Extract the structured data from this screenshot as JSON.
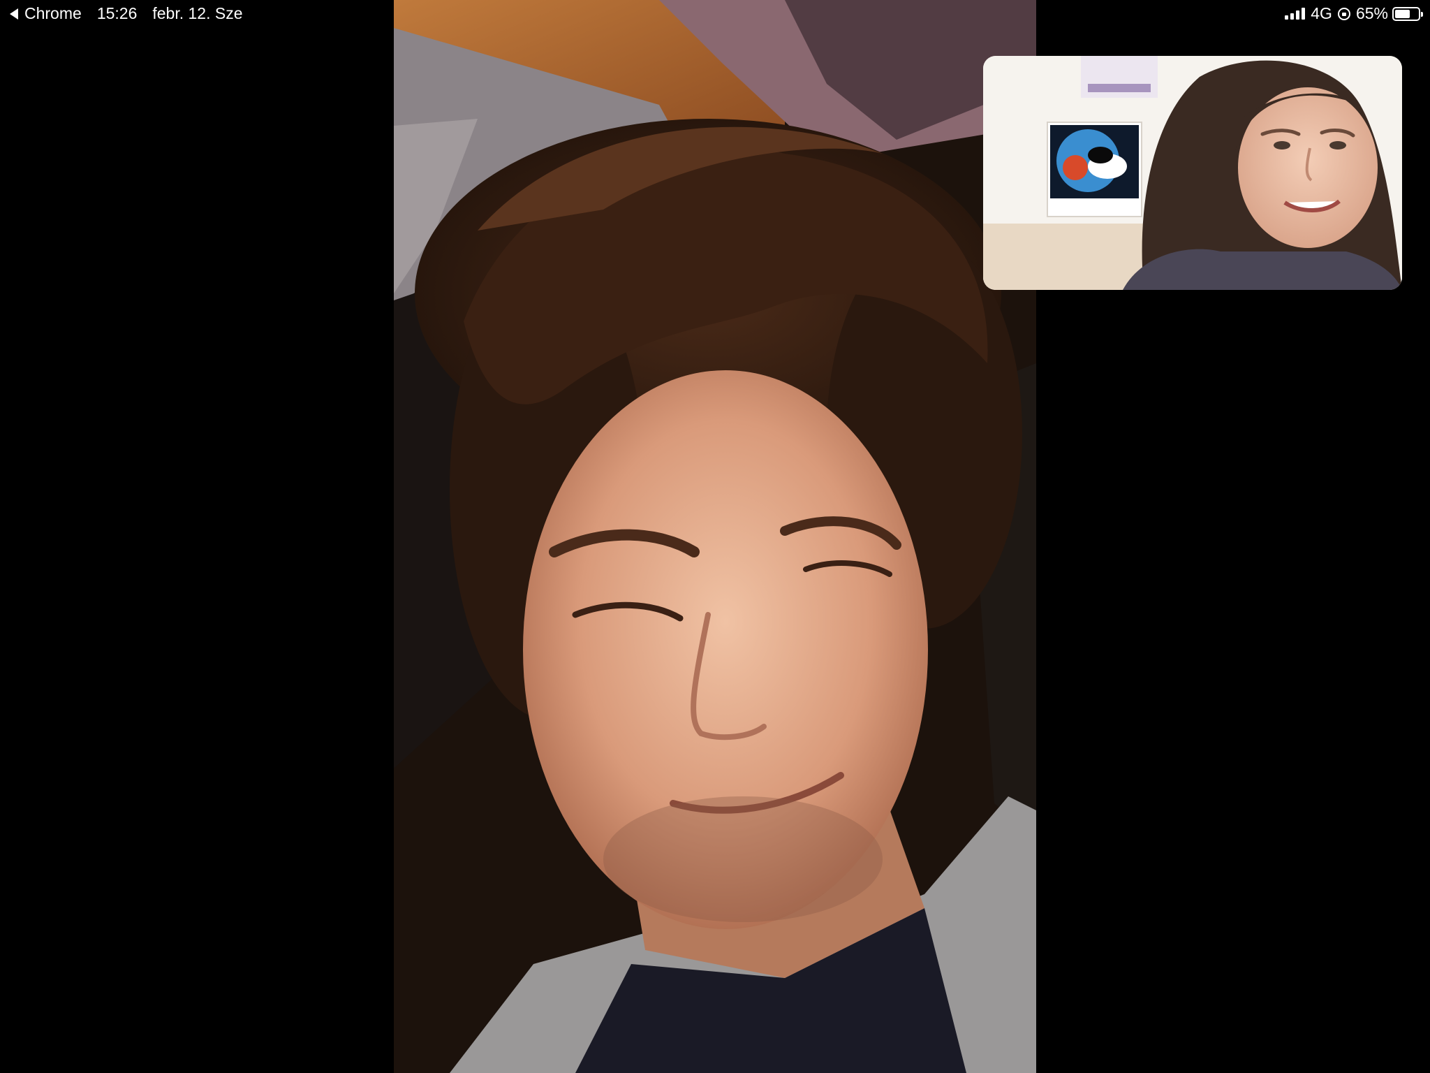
{
  "status_bar": {
    "back_app": "Chrome",
    "time": "15:26",
    "date": "febr. 12. Sze",
    "network": "4G",
    "battery_percent_label": "65%",
    "battery_level": 0.65
  },
  "call": {
    "remote_video": {
      "description_icon": "remote-participant-video"
    },
    "self_view": {
      "description_icon": "local-camera-preview"
    }
  },
  "colors": {
    "background": "#000000",
    "status_text": "#ffffff"
  }
}
